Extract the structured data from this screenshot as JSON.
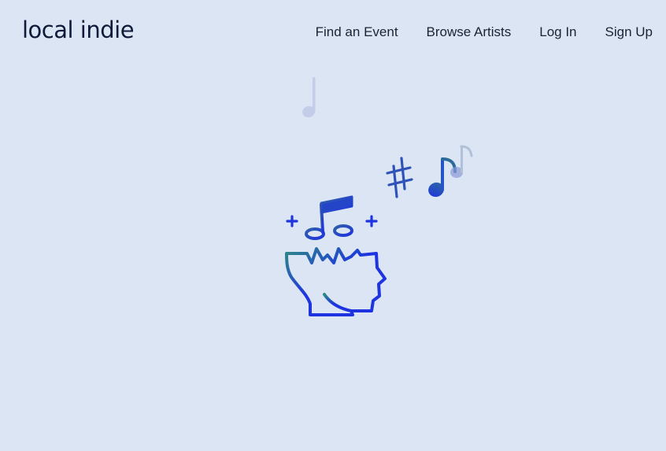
{
  "header": {
    "logo_text": "local indie",
    "nav": [
      {
        "label": "Find an Event"
      },
      {
        "label": "Browse Artists"
      },
      {
        "label": "Log In"
      },
      {
        "label": "Sign Up"
      }
    ]
  },
  "colors": {
    "background": "#dce5f3",
    "text_dark": "#0f1a3a",
    "icon_blue": "#1e34e0",
    "icon_teal": "#2e8a86",
    "note_faded": "#c3cdea",
    "note_light": "#8fa3c8"
  },
  "illustration": {
    "icons": [
      "music-note-icon",
      "sharp-symbol-icon",
      "eighth-note-icon",
      "beamed-notes-icon",
      "head-profile-icon"
    ]
  }
}
